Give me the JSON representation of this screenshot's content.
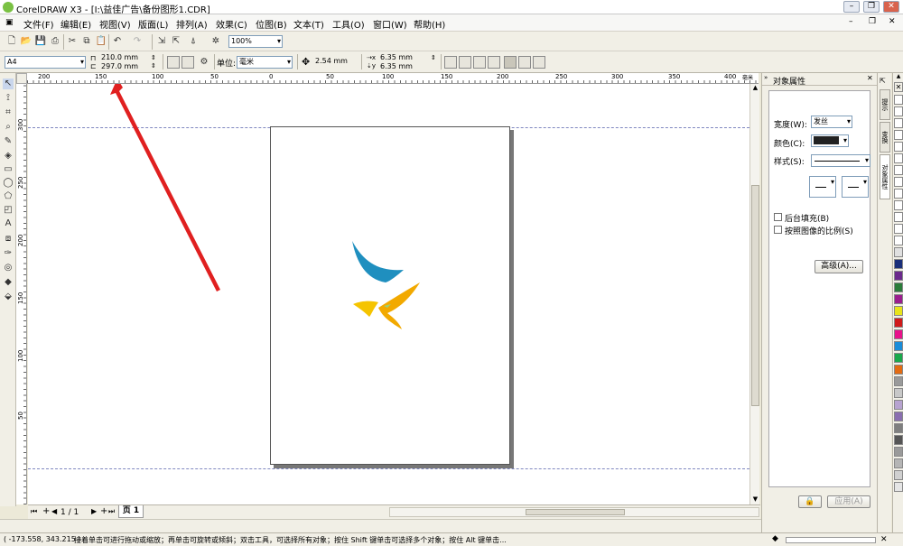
{
  "window": {
    "title": "CorelDRAW X3 - [I:\\益佳广告\\备份图形1.CDR]"
  },
  "menu": [
    "文件(F)",
    "编辑(E)",
    "视图(V)",
    "版面(L)",
    "排列(A)",
    "效果(C)",
    "位图(B)",
    "文本(T)",
    "工具(O)",
    "窗口(W)",
    "帮助(H)"
  ],
  "toolbar": {
    "zoom": "100%"
  },
  "property_bar": {
    "paper_size": "A4",
    "width": "210.0 mm",
    "height": "297.0 mm",
    "unit_label": "单位:",
    "unit_value": "毫米",
    "nudge": "2.54 mm",
    "dup_x": "6.35 mm",
    "dup_y": "6.35 mm"
  },
  "ruler": {
    "h_ticks": [
      "200",
      "150",
      "100",
      "50",
      "0",
      "50",
      "100",
      "150",
      "200",
      "250",
      "300",
      "350",
      "400"
    ],
    "h_unit": "毫米",
    "v_ticks": [
      "300",
      "250",
      "200",
      "150",
      "100",
      "50"
    ]
  },
  "page_nav": {
    "count": "1 / 1",
    "tab": "页 1"
  },
  "status": {
    "coords": "( -173.558, 343.215 )",
    "message": "接着单击可进行拖动或缩放；再单击可旋转或倾斜；双击工具，可选择所有对象；按住 Shift 键单击可选择多个对象；按住 Alt 键单击..."
  },
  "docker": {
    "title": "对象属性",
    "width_label": "宽度(W):",
    "width_value": "发丝",
    "color_label": "颜色(C):",
    "style_label": "样式(S):",
    "bg_fill_label": "后台填充(B)",
    "scale_label": "按照图像的比例(S)",
    "advanced_btn": "高级(A)...",
    "apply_btn": "应用(A)"
  },
  "docker_tabs": [
    "提示",
    "变换",
    "对象属性"
  ],
  "colors": {
    "swatches": [
      "#ffffff",
      "#ffffff",
      "#ffffff",
      "#ffffff",
      "#ffffff",
      "#ffffff",
      "#ffffff",
      "#ffffff",
      "#ffffff",
      "#ffffff",
      "#ffffff",
      "#ffffff",
      "#ffffff",
      "#e0e0e0",
      "#1a2f7a",
      "#6b2a8c",
      "#2b7c3a",
      "#9b1d8e",
      "#e8e41a",
      "#d01a1a",
      "#e8128a",
      "#1a8dd9",
      "#1aa84b",
      "#e36b12",
      "#9a9a9a",
      "#c8c8c8",
      "#b7a3d0",
      "#8a6fb0",
      "#7f7f7f",
      "#555555",
      "#9a9a9a",
      "#b5b5b5",
      "#d0d0d0",
      "#e5e5e5"
    ]
  }
}
